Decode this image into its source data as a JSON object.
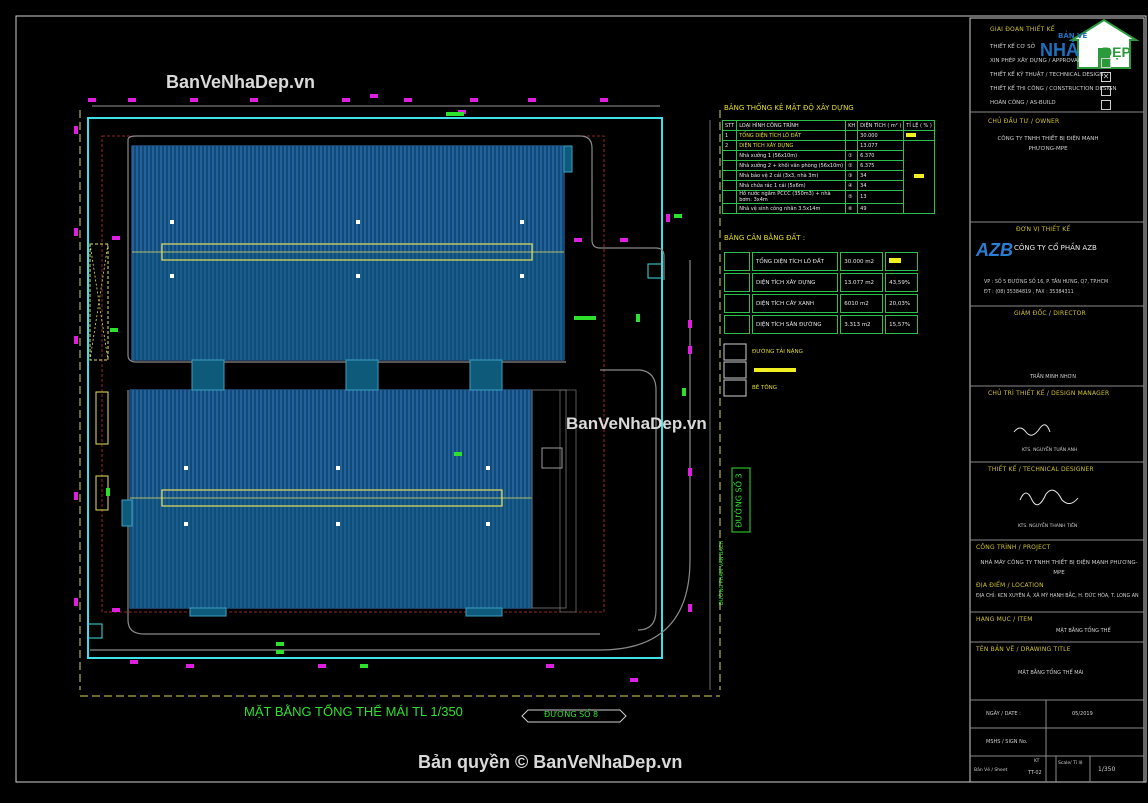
{
  "watermarks": {
    "top_left": "BanVeNhaDep.vn",
    "middle": "BanVeNhaDep.vn",
    "copyright": "Bản quyền © BanVeNhaDep.vn"
  },
  "logo": {
    "line1": "BẢN VẼ",
    "line2_a": "NHÀ",
    "line2_b": "ĐẸP"
  },
  "drawing": {
    "title": "MẶT BẰNG TỔNG THỂ MÁI TL 1/350",
    "road_bottom": "ĐƯỜNG SỐ 8",
    "road_right": "ĐƯỜNG SỐ 3",
    "road_right_small": "ĐƯỜNG PHẠM VĂN BẠCH"
  },
  "density_table": {
    "title": "BẢNG THỐNG KÊ MẬT ĐỘ XÂY DỰNG",
    "headers": [
      "STT",
      "LOẠI HÌNH CÔNG TRÌNH",
      "KH",
      "DIỆN TÍCH ( m² )",
      "TỈ LỆ ( % )"
    ],
    "rows": [
      [
        "1",
        "TỔNG DIỆN TÍCH LÔ ĐẤT",
        "",
        "30.000",
        ""
      ],
      [
        "2",
        "DIỆN TÍCH XÂY DỰNG",
        "",
        "13.077",
        ""
      ],
      [
        "",
        "Nhà xưởng 1 (56x10m)",
        "①",
        "6.370",
        ""
      ],
      [
        "",
        "Nhà xưởng 2 + khối văn phòng (56x10m)",
        "②",
        "6.375",
        ""
      ],
      [
        "",
        "Nhà bảo vệ 2 cái (3x3, nhà 3m)",
        "③",
        "34",
        ""
      ],
      [
        "",
        "Nhà chứa rác 1 cái (5x6m)",
        "④",
        "34",
        ""
      ],
      [
        "",
        "Hồ nước ngầm PCCC (350m3) + nhà bơm: 3x4m",
        "⑤",
        "13",
        ""
      ],
      [
        "",
        "Nhà vệ sinh công nhân 3.5x14m",
        "⑥",
        "49",
        ""
      ]
    ]
  },
  "balance_table": {
    "title": "BẢNG CÂN BẰNG ĐẤT :",
    "rows": [
      [
        "TỔNG DIỆN TÍCH LÔ ĐẤT",
        "30.000 m2",
        ""
      ],
      [
        "DIỆN TÍCH XÂY DỰNG",
        "13.077 m2",
        "43,59%"
      ],
      [
        "DIỆN TÍCH CÂY XANH",
        "6010 m2",
        "20,03%"
      ],
      [
        "DIỆN TÍCH SÂN ĐƯỜNG",
        "3.313 m2",
        "15,57%"
      ]
    ]
  },
  "legend": {
    "road": "ĐƯỜNG TẢI NẶNG",
    "concrete": "BÊ TÔNG"
  },
  "title_block": {
    "stage_header": "GIAI ĐOẠN THIẾT KẾ",
    "stages": [
      {
        "label": "THIẾT KẾ CƠ SỞ",
        "checked": false
      },
      {
        "label": "XIN PHÉP XÂY DỰNG / APPROVAL",
        "checked": false
      },
      {
        "label": "THIẾT KẾ KỸ THUẬT / TECHNICAL DESIGN",
        "checked": true
      },
      {
        "label": "THIẾT KẾ THI CÔNG / CONSTRUCTION DESIGN",
        "checked": false
      },
      {
        "label": "HOÀN CÔNG / AS-BUILD",
        "checked": false
      }
    ],
    "owner_header": "CHỦ ĐẦU TƯ / OWNER",
    "owner": "CÔNG TY TNHH THIẾT BỊ ĐIỆN MẠNH PHƯƠNG-MPE",
    "designer_header": "ĐƠN VỊ THIẾT KẾ",
    "designer_logo": "AZB",
    "designer_name": "CÔNG TY CỔ PHẦN AZB",
    "designer_address": "VP : SỐ 5 ĐƯỜNG SỐ 16, P. TÂN HƯNG, Q7, TP.HCM",
    "designer_phone": "ĐT : (08) 35384819 , FAX : 35384311",
    "director_header": "GIÁM ĐỐC / DIRECTOR",
    "director_name": "TRẦN MINH NHƠN",
    "chief_header": "CHỦ TRÌ THIẾT KẾ / DESIGN MANAGER",
    "chief_name": "KTS. NGUYỄN TUẤN ANH",
    "designer2_header": "THIẾT KẾ / TECHNICAL DESIGNER",
    "designer2_name": "KTS. NGUYỄN THANH TIẾN",
    "project_header": "CÔNG TRÌNH / PROJECT",
    "project_name": "NHÀ MÁY CÔNG TY TNHH THIẾT BỊ ĐIỆN MẠNH PHƯƠNG-MPE",
    "location_header": "ĐỊA ĐIỂM / LOCATION",
    "location": "ĐỊA CHỈ: KCN XUYÊN Á, XÃ MỸ HẠNH BẮC, H. ĐỨC HÒA, T. LONG AN",
    "drawing_header": "HẠNG MỤC / ITEM",
    "drawing_name": "MẶT BẰNG TỔNG THỂ",
    "sheet_header": "TÊN BẢN VẼ / DRAWING TITLE",
    "sheet_name": "MẶT BẰNG TỔNG THỂ MÁI",
    "date_label": "NGÀY / DATE :",
    "date_value": "05/2019",
    "msns_label": "MSHS / SIGN No.",
    "sheet_no_label": "Bản Vẽ / Sheet",
    "kt": "KT",
    "sheet_no": "TT-02",
    "scale_label": "Scale/ Tỉ lệ",
    "scale_value": "1/350"
  }
}
